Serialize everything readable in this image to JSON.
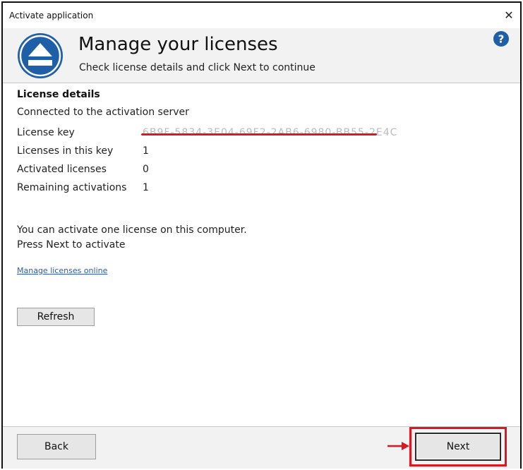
{
  "window": {
    "title": "Activate application",
    "close_glyph": "✕"
  },
  "header": {
    "title": "Manage your licenses",
    "subtitle": "Check license details and click Next to continue",
    "logo_icon": "eject-icon",
    "help_icon": "help-icon",
    "accent_color": "#1f5fa8"
  },
  "content": {
    "section_title": "License details",
    "status": "Connected to the activation server",
    "details": [
      {
        "label": "License key",
        "value": "6B9F-5834-3E04-69F2-2AB6-6980-BB55-2E4C",
        "redacted": true
      },
      {
        "label": "Licenses in this key",
        "value": "1"
      },
      {
        "label": "Activated licenses",
        "value": "0"
      },
      {
        "label": "Remaining activations",
        "value": "1"
      }
    ],
    "info_line1": "You can activate one license on this computer.",
    "info_line2": "Press Next to activate",
    "manage_link": "Manage licenses online",
    "refresh_label": "Refresh"
  },
  "footer": {
    "back_label": "Back",
    "next_label": "Next",
    "highlight_color": "#e0151f"
  }
}
